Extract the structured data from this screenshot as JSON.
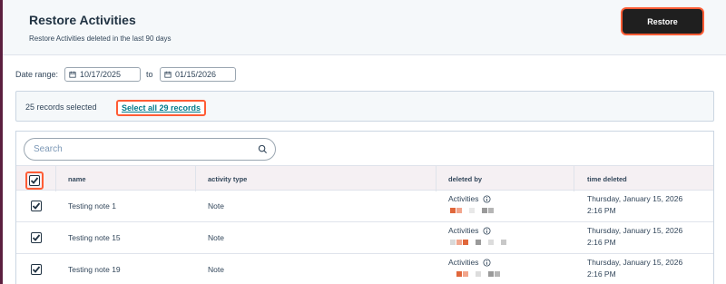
{
  "header": {
    "title": "Restore Activities",
    "subtitle": "Restore Activities deleted in the last 90 days",
    "restore_label": "Restore"
  },
  "filters": {
    "date_range_label": "Date range:",
    "start_date": "10/17/2025",
    "to_label": "to",
    "end_date": "01/15/2026"
  },
  "selection": {
    "summary": "25 records selected",
    "select_all_label": "Select all 29 records"
  },
  "search": {
    "placeholder": "Search"
  },
  "table": {
    "columns": {
      "name": "name",
      "activity_type": "activity type",
      "deleted_by": "deleted by",
      "time_deleted": "time deleted"
    },
    "rows": [
      {
        "name": "Testing note 1",
        "activity_type": "Note",
        "deleted_by": "Activities",
        "time_date": "Thursday, January 15, 2026",
        "time_clock": "2:16 PM",
        "checked": true
      },
      {
        "name": "Testing note 15",
        "activity_type": "Note",
        "deleted_by": "Activities",
        "time_date": "Thursday, January 15, 2026",
        "time_clock": "2:16 PM",
        "checked": true
      },
      {
        "name": "Testing note 19",
        "activity_type": "Note",
        "deleted_by": "Activities",
        "time_date": "Thursday, January 15, 2026",
        "time_clock": "2:16 PM",
        "checked": true
      }
    ]
  },
  "colors": {
    "highlight": "#ff5c35",
    "link": "#007a8c",
    "button_bg": "#1f1f1f",
    "text": "#213343"
  },
  "icons": [
    "calendar-icon",
    "search-icon",
    "checkbox-checked-icon",
    "info-icon"
  ]
}
